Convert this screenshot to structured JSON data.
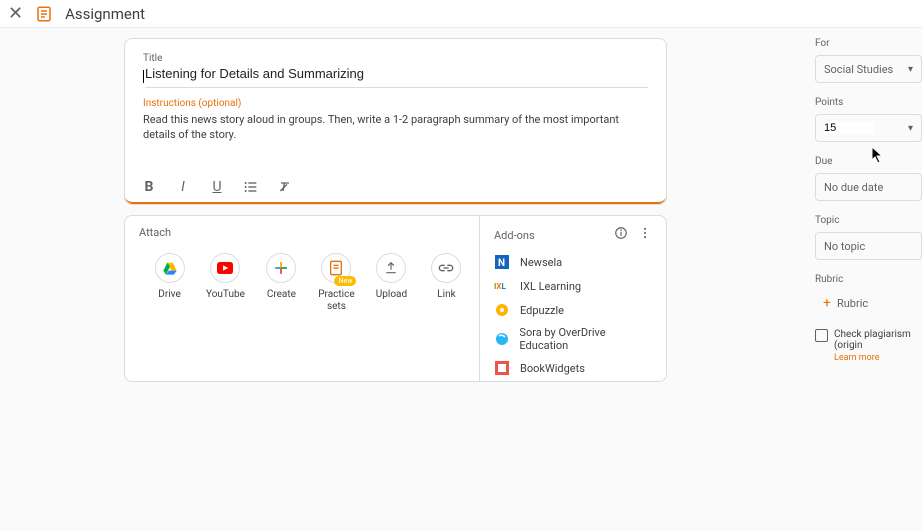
{
  "topbar": {
    "title": "Assignment"
  },
  "main": {
    "title_label": "Title",
    "title_value": "Listening for Details and Summarizing",
    "instructions_label": "Instructions (optional)",
    "instructions_text": "Read this news story aloud in groups. Then, write a 1-2 paragraph summary of the most important details of the story."
  },
  "attach": {
    "label": "Attach",
    "items": [
      {
        "label": "Drive"
      },
      {
        "label": "YouTube"
      },
      {
        "label": "Create"
      },
      {
        "label": "Practice sets",
        "badge": "New"
      },
      {
        "label": "Upload"
      },
      {
        "label": "Link"
      }
    ]
  },
  "addons": {
    "label": "Add-ons",
    "items": [
      {
        "label": "Newsela"
      },
      {
        "label": "IXL Learning"
      },
      {
        "label": "Edpuzzle"
      },
      {
        "label": "Sora by OverDrive Education"
      },
      {
        "label": "BookWidgets"
      }
    ]
  },
  "sidebar": {
    "for_label": "For",
    "for_value": "Social Studies",
    "points_label": "Points",
    "points_value": "15",
    "due_label": "Due",
    "due_value": "No due date",
    "topic_label": "Topic",
    "topic_value": "No topic",
    "rubric_label": "Rubric",
    "rubric_button": "Rubric",
    "plagiarism_label": "Check plagiarism (origin",
    "learn_more": "Learn more"
  }
}
